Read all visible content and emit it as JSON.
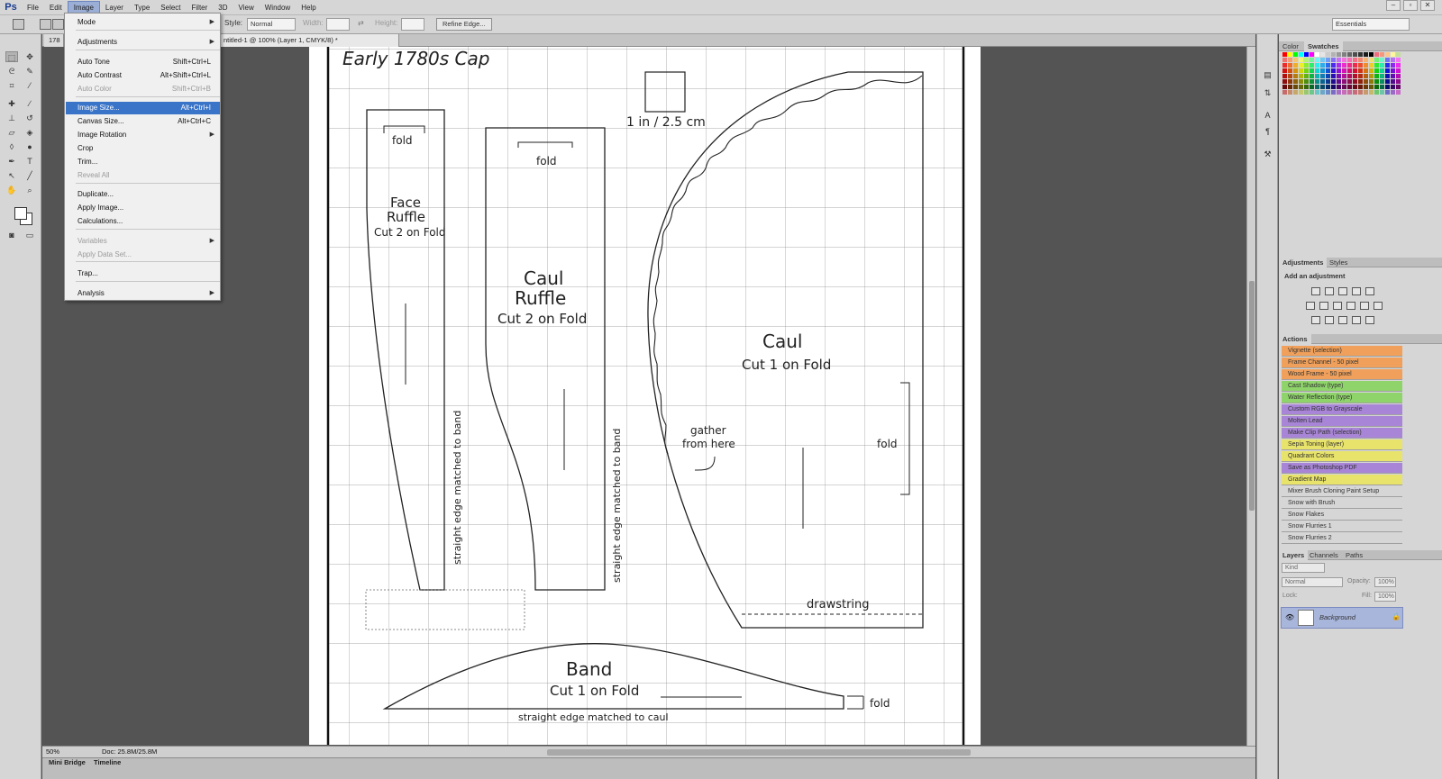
{
  "app": {
    "logo": "Ps"
  },
  "menubar": {
    "items": [
      "File",
      "Edit",
      "Image",
      "Layer",
      "Type",
      "Select",
      "Filter",
      "3D",
      "View",
      "Window",
      "Help"
    ],
    "active": "Image"
  },
  "window_controls": [
    "–",
    "▫",
    "✕"
  ],
  "options_bar": {
    "style_label": "Style:",
    "style_value": "Normal",
    "width_label": "Width:",
    "height_label": "Height:",
    "refine_edge": "Refine Edge...",
    "workspace": "Essentials"
  },
  "doc_tabs": [
    "178",
    "ntitled-1 @ 100% (Layer 1, CMYK/8) *"
  ],
  "image_menu": {
    "items": [
      {
        "label": "Mode",
        "shortcut": "",
        "submenu": true,
        "enabled": true
      },
      {
        "label": "Adjustments",
        "shortcut": "",
        "submenu": true,
        "enabled": true
      },
      {
        "label": "Auto Tone",
        "shortcut": "Shift+Ctrl+L",
        "submenu": false,
        "enabled": true
      },
      {
        "label": "Auto Contrast",
        "shortcut": "Alt+Shift+Ctrl+L",
        "submenu": false,
        "enabled": true
      },
      {
        "label": "Auto Color",
        "shortcut": "Shift+Ctrl+B",
        "submenu": false,
        "enabled": false
      },
      {
        "label": "Image Size...",
        "shortcut": "Alt+Ctrl+I",
        "submenu": false,
        "enabled": true,
        "highlighted": true
      },
      {
        "label": "Canvas Size...",
        "shortcut": "Alt+Ctrl+C",
        "submenu": false,
        "enabled": true
      },
      {
        "label": "Image Rotation",
        "shortcut": "",
        "submenu": true,
        "enabled": true
      },
      {
        "label": "Crop",
        "shortcut": "",
        "submenu": false,
        "enabled": true
      },
      {
        "label": "Trim...",
        "shortcut": "",
        "submenu": false,
        "enabled": true
      },
      {
        "label": "Reveal All",
        "shortcut": "",
        "submenu": false,
        "enabled": false
      },
      {
        "label": "Duplicate...",
        "shortcut": "",
        "submenu": false,
        "enabled": true
      },
      {
        "label": "Apply Image...",
        "shortcut": "",
        "submenu": false,
        "enabled": true
      },
      {
        "label": "Calculations...",
        "shortcut": "",
        "submenu": false,
        "enabled": true
      },
      {
        "label": "Variables",
        "shortcut": "",
        "submenu": true,
        "enabled": false
      },
      {
        "label": "Apply Data Set...",
        "shortcut": "",
        "submenu": false,
        "enabled": false
      },
      {
        "label": "Trap...",
        "shortcut": "",
        "submenu": false,
        "enabled": true
      },
      {
        "label": "Analysis",
        "shortcut": "",
        "submenu": true,
        "enabled": true
      }
    ]
  },
  "status": {
    "zoom": "50%",
    "doc_size": "Doc: 25.8M/25.8M"
  },
  "bottom_tabs": [
    "Mini Bridge",
    "Timeline"
  ],
  "panels": {
    "color_tabs": [
      "Color",
      "Swatches"
    ],
    "adjustments_tabs": [
      "Adjustments",
      "Styles"
    ],
    "adjustments_hint": "Add an adjustment",
    "actions_tab": "Actions",
    "actions": [
      {
        "label": "Vignette (selection)",
        "color": "#f0a05a"
      },
      {
        "label": "Frame Channel - 50 pixel",
        "color": "#f0a05a"
      },
      {
        "label": "Wood Frame - 50 pixel",
        "color": "#f0a05a"
      },
      {
        "label": "Cast Shadow (type)",
        "color": "#8fd36b"
      },
      {
        "label": "Water Reflection (type)",
        "color": "#8fd36b"
      },
      {
        "label": "Custom RGB to Grayscale",
        "color": "#a885d6"
      },
      {
        "label": "Molten Lead",
        "color": "#a885d6"
      },
      {
        "label": "Make Clip Path (selection)",
        "color": "#a885d6"
      },
      {
        "label": "Sepia Toning (layer)",
        "color": "#e8e36a"
      },
      {
        "label": "Quadrant Colors",
        "color": "#e8e36a"
      },
      {
        "label": "Save as Photoshop PDF",
        "color": "#a885d6"
      },
      {
        "label": "Gradient Map",
        "color": "#e8e36a"
      },
      {
        "label": "Mixer Brush Cloning Paint Setup",
        "color": "#d6d6d6"
      },
      {
        "label": "Snow with Brush",
        "color": "#d6d6d6"
      },
      {
        "label": "Snow Flakes",
        "color": "#d6d6d6"
      },
      {
        "label": "Snow Flurries 1",
        "color": "#d6d6d6"
      },
      {
        "label": "Snow Flurries 2",
        "color": "#d6d6d6"
      }
    ],
    "layers_tabs": [
      "Layers",
      "Channels",
      "Paths"
    ],
    "layer_kind": "Kind",
    "blend_mode": "Normal",
    "opacity_label": "Opacity:",
    "opacity_value": "100%",
    "lock_label": "Lock:",
    "fill_label": "Fill:",
    "fill_value": "100%",
    "layer_name": "Background"
  },
  "pattern": {
    "title": "Early 1780s Cap",
    "scale_label": "1 in / 2.5 cm",
    "face_ruffle": [
      "Face",
      "Ruffle",
      "Cut 2 on Fold"
    ],
    "caul_ruffle": [
      "Caul",
      "Ruffle",
      "Cut 2 on Fold"
    ],
    "caul": [
      "Caul",
      "Cut 1 on Fold"
    ],
    "band": [
      "Band",
      "Cut 1 on Fold"
    ],
    "fold": "fold",
    "gather": [
      "gather",
      "from here"
    ],
    "drawstring": "drawstring",
    "straight_band": "straight edge matched to band",
    "straight_caul": "straight edge matched to caul"
  }
}
